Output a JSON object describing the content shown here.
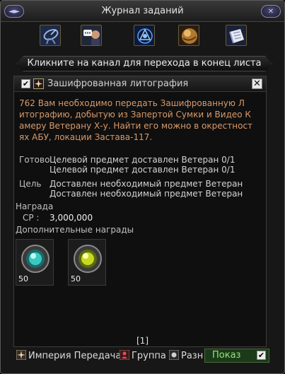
{
  "window": {
    "title": "Журнал заданий",
    "btn_left": "◄►",
    "btn_right": "✕"
  },
  "channels": [
    {
      "name": "satellite-dish-icon"
    },
    {
      "name": "chat-portrait-icon"
    },
    {
      "name": "blue-emblem-icon"
    },
    {
      "name": "golden-orb-icon"
    },
    {
      "name": "scroll-book-icon"
    }
  ],
  "banner_text": "Кликните на канал для перехода в конец листа",
  "quest": {
    "checkbox": "✔",
    "title": "Зашифрованная литография",
    "close": "✕",
    "description": [
      "762  Вам необходимо передать Зашифрованную Л",
      "итографию, добытую из Запертой Сумки и Видео К",
      "амеру Ветерану Х-у. Найти его можно в окрестност",
      "ях АБУ, локации Застава-117."
    ],
    "ready_label": "Готово",
    "ready_lines": [
      "Целевой предмет доставлен Ветеран   0/1",
      "Целевой предмет доставлен Ветеран   0/1"
    ],
    "goal_label": "Цель",
    "goal_lines": [
      "Доставлен необходимый предмет Ветеран",
      "Доставлен необходимый предмет Ветеран"
    ],
    "reward_label": "Награда",
    "cp_label": "CP :",
    "cp_value": "3,000,000",
    "extra_rewards_label": "Дополнительные награды",
    "rewards": [
      {
        "count": "50",
        "color": "#3cc8c0"
      },
      {
        "count": "50",
        "color": "#c8d820"
      }
    ]
  },
  "page_indicator": "[1]",
  "bottom": {
    "empire": "Империя Передача",
    "group": "Группа",
    "misc": "Разн",
    "show": "Показ",
    "show_check": "✔"
  }
}
